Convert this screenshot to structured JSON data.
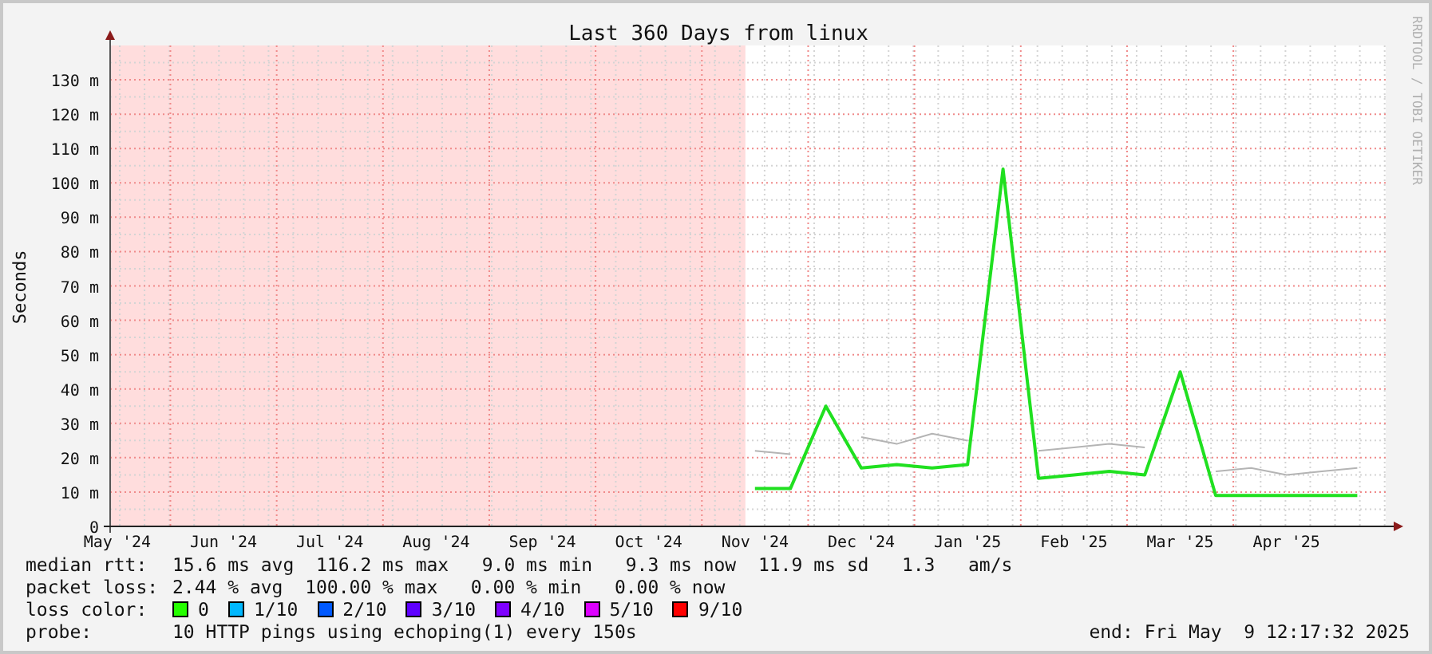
{
  "graph": {
    "title": "Last 360 Days from linux",
    "watermark": "RRDTOOL / TOBI OETIKER",
    "chart_data": {
      "type": "line",
      "grid": true,
      "ylabel": "Seconds",
      "ylim": [
        0,
        140
      ],
      "yticks": [
        {
          "value": 0,
          "label": "0"
        },
        {
          "value": 10,
          "label": "10 m"
        },
        {
          "value": 20,
          "label": "20 m"
        },
        {
          "value": 30,
          "label": "30 m"
        },
        {
          "value": 40,
          "label": "40 m"
        },
        {
          "value": 50,
          "label": "50 m"
        },
        {
          "value": 60,
          "label": "60 m"
        },
        {
          "value": 70,
          "label": "70 m"
        },
        {
          "value": 80,
          "label": "80 m"
        },
        {
          "value": 90,
          "label": "90 m"
        },
        {
          "value": 100,
          "label": "100 m"
        },
        {
          "value": 110,
          "label": "110 m"
        },
        {
          "value": 120,
          "label": "120 m"
        },
        {
          "value": 130,
          "label": "130 m"
        }
      ],
      "categories": [
        "May '24",
        null,
        null,
        "Jun '24",
        null,
        null,
        "Jul '24",
        null,
        null,
        "Aug '24",
        null,
        null,
        "Sep '24",
        null,
        null,
        "Oct '24",
        null,
        null,
        "Nov '24",
        null,
        null,
        "Dec '24",
        null,
        null,
        "Jan '25",
        null,
        null,
        "Feb '25",
        null,
        null,
        "Mar '25",
        null,
        null,
        "Apr '25",
        null,
        null
      ],
      "series": [
        {
          "color": "#20e020",
          "values": [
            null,
            null,
            null,
            null,
            null,
            null,
            null,
            null,
            null,
            null,
            null,
            null,
            null,
            null,
            null,
            null,
            null,
            null,
            11,
            11,
            35,
            17,
            18,
            17,
            18,
            104,
            14,
            15,
            16,
            15,
            45,
            9,
            9,
            9,
            9,
            9
          ]
        },
        {
          "color": "#b4b4b4",
          "values": [
            null,
            null,
            null,
            null,
            null,
            null,
            null,
            null,
            null,
            null,
            null,
            null,
            null,
            null,
            null,
            null,
            null,
            null,
            22,
            21,
            null,
            26,
            24,
            27,
            25,
            null,
            22,
            23,
            24,
            23,
            null,
            16,
            17,
            15,
            16,
            17
          ]
        }
      ]
    }
  },
  "legend": {
    "rows": [
      {
        "label": "median rtt:",
        "value": "15.6 ms avg  116.2 ms max   9.0 ms min   9.3 ms now  11.9 ms sd   1.3   am/s"
      },
      {
        "label": "packet loss:",
        "value": "2.44 % avg  100.00 % max   0.00 % min   0.00 % now"
      }
    ],
    "loss_label": "loss color:",
    "loss_colors": [
      {
        "label": "0",
        "color": "#26ff00"
      },
      {
        "label": "1/10",
        "color": "#00b8ff"
      },
      {
        "label": "2/10",
        "color": "#0059ff"
      },
      {
        "label": "3/10",
        "color": "#5e00ff"
      },
      {
        "label": "4/10",
        "color": "#7e00ff"
      },
      {
        "label": "5/10",
        "color": "#dd00ff"
      },
      {
        "label": "9/10",
        "color": "#ff0000"
      }
    ],
    "probe_label": "probe:",
    "probe": "10 HTTP pings using echoping(1) every 150s",
    "end": "end: Fri May  9 12:17:32 2025"
  }
}
